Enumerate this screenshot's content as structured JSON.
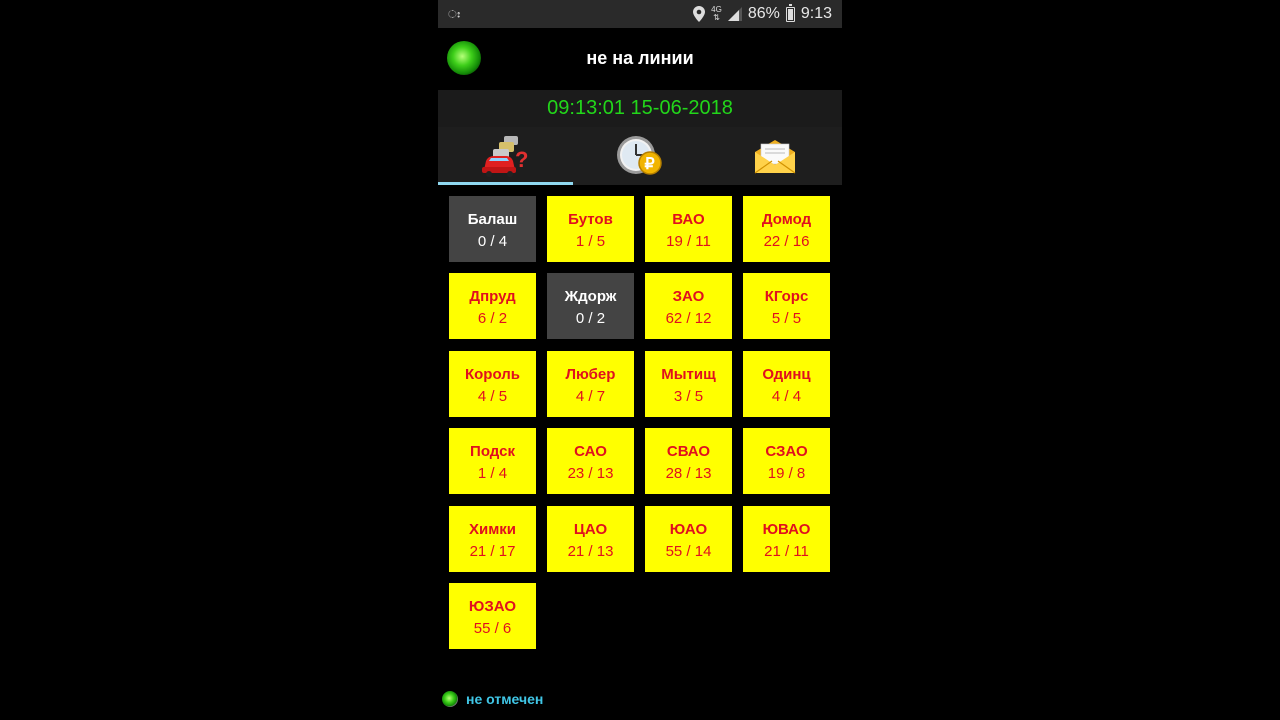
{
  "status_bar": {
    "notification": "ഃ",
    "network": "4G",
    "battery": "86%",
    "time": "9:13",
    "icons": [
      "location-icon",
      "network-4g-icon",
      "signal-icon",
      "battery-icon"
    ]
  },
  "header": {
    "status_title": "не на линии",
    "status_color": "#3ecf1a"
  },
  "clock": "09:13:01 15-06-2018",
  "tabs": [
    {
      "icon": "cars-question-icon",
      "active": true
    },
    {
      "icon": "clock-ruble-icon",
      "active": false
    },
    {
      "icon": "envelope-icon",
      "active": false
    }
  ],
  "zones": [
    {
      "name": "Балаш",
      "count": "0 / 4",
      "state": "gray"
    },
    {
      "name": "Бутов",
      "count": "1 / 5",
      "state": "yellow"
    },
    {
      "name": "ВАО",
      "count": "19 / 11",
      "state": "yellow"
    },
    {
      "name": "Домод",
      "count": "22 / 16",
      "state": "yellow"
    },
    {
      "name": "Дпруд",
      "count": "6 / 2",
      "state": "yellow"
    },
    {
      "name": "Ждорж",
      "count": "0 / 2",
      "state": "gray"
    },
    {
      "name": "ЗАО",
      "count": "62 / 12",
      "state": "yellow"
    },
    {
      "name": "КГорс",
      "count": "5 / 5",
      "state": "yellow"
    },
    {
      "name": "Король",
      "count": "4 / 5",
      "state": "yellow"
    },
    {
      "name": "Любер",
      "count": "4 / 7",
      "state": "yellow"
    },
    {
      "name": "Мытищ",
      "count": "3 / 5",
      "state": "yellow"
    },
    {
      "name": "Одинц",
      "count": "4 / 4",
      "state": "yellow"
    },
    {
      "name": "Подск",
      "count": "1 / 4",
      "state": "yellow"
    },
    {
      "name": "САО",
      "count": "23 / 13",
      "state": "yellow"
    },
    {
      "name": "СВАО",
      "count": "28 / 13",
      "state": "yellow"
    },
    {
      "name": "СЗАО",
      "count": "19 / 8",
      "state": "yellow"
    },
    {
      "name": "Химки",
      "count": "21 / 17",
      "state": "yellow"
    },
    {
      "name": "ЦАО",
      "count": "21 / 13",
      "state": "yellow"
    },
    {
      "name": "ЮАО",
      "count": "55 / 14",
      "state": "yellow"
    },
    {
      "name": "ЮВАО",
      "count": "21 / 11",
      "state": "yellow"
    },
    {
      "name": "ЮЗАО",
      "count": "55 / 6",
      "state": "yellow"
    }
  ],
  "footer": {
    "text": "не отмечен"
  },
  "colors": {
    "tile_active": "#ffff00",
    "tile_inactive": "#444444",
    "tile_text": "#e0101e",
    "clock_text": "#22d61a",
    "footer_text": "#40c6e6"
  }
}
